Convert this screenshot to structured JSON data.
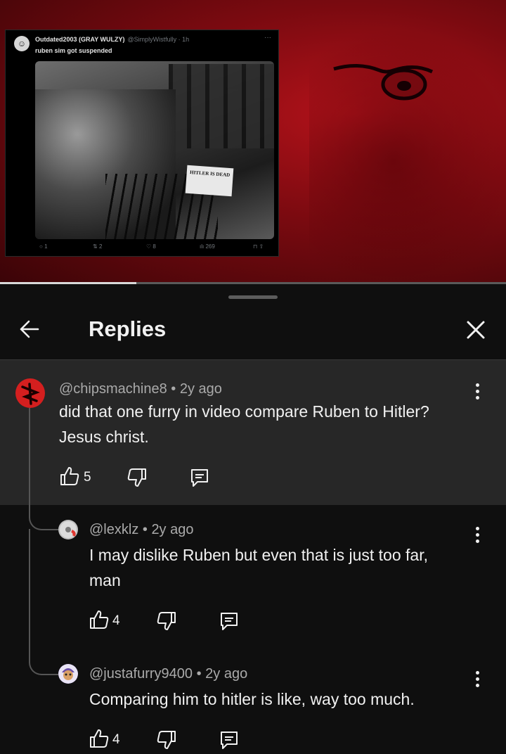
{
  "video": {
    "tweet": {
      "avatar_glyph": "☺",
      "name": "Outdated2003 (GRAY WULZY)",
      "handle": "@SimplyWistfully · 1h",
      "more": "···",
      "text": "ruben sim got suspended",
      "photo_sign": "HITLER IS DEAD",
      "replies": "1",
      "retweets": "2",
      "likes": "8",
      "views": "269"
    },
    "progress_fraction": 0.27
  },
  "panel": {
    "title": "Replies",
    "back_icon": "arrow-left-icon",
    "close_icon": "close-icon"
  },
  "comments": [
    {
      "id": "chipsmachine8",
      "author": "@chipsmachine8",
      "age": "2y ago",
      "text_lines": [
        "did that one furry in video compare Ruben to Hitler?",
        "Jesus christ."
      ],
      "likes": "5",
      "avatar_color": "#d41f1f"
    },
    {
      "id": "lexklz",
      "author": "@lexklz",
      "age": "2y ago",
      "text_lines": [
        "I may dislike Ruben but even that is just too far,",
        "man"
      ],
      "likes": "4",
      "avatar_color": "#bfbfbf"
    },
    {
      "id": "justafurry9400",
      "author": "@justafurry9400",
      "age": "2y ago",
      "text_lines": [
        "Comparing him to hitler is like, way too much."
      ],
      "likes": "4",
      "avatar_color": "#6b4fa8"
    }
  ],
  "colors": {
    "panel_bg": "#0f0f0f",
    "highlight_bg": "#272727",
    "meta_text": "#aaaaaa",
    "accent_red": "#b3121a"
  }
}
